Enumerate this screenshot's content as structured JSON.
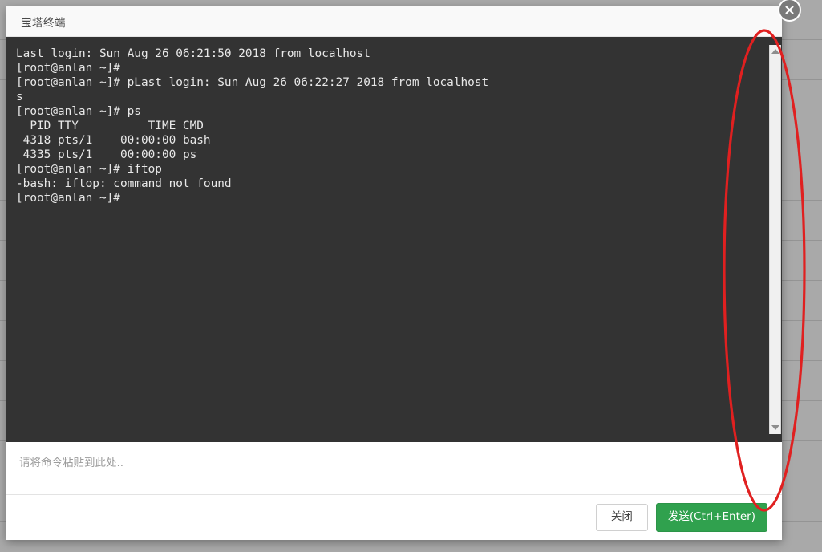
{
  "window": {
    "title": "宝塔终端",
    "close_icon": "close-circle-icon"
  },
  "terminal": {
    "background_color": "#333333",
    "text_color": "#e8e8e8",
    "lines": [
      "Last login: Sun Aug 26 06:21:50 2018 from localhost",
      "[root@anlan ~]#",
      "[root@anlan ~]# pLast login: Sun Aug 26 06:22:27 2018 from localhost",
      "s",
      "[root@anlan ~]# ps",
      "  PID TTY          TIME CMD",
      " 4318 pts/1    00:00:00 bash",
      " 4335 pts/1    00:00:00 ps",
      "[root@anlan ~]# iftop",
      "-bash: iftop: command not found",
      "[root@anlan ~]#"
    ],
    "content": "Last login: Sun Aug 26 06:21:50 2018 from localhost\n[root@anlan ~]#\n[root@anlan ~]# pLast login: Sun Aug 26 06:22:27 2018 from localhost\ns\n[root@anlan ~]# ps\n  PID TTY          TIME CMD\n 4318 pts/1    00:00:00 bash\n 4335 pts/1    00:00:00 ps\n[root@anlan ~]# iftop\n-bash: iftop: command not found\n[root@anlan ~]#"
  },
  "scrollbar": {
    "up_arrow_icon": "triangle-up-icon",
    "down_arrow_icon": "triangle-down-icon"
  },
  "input": {
    "placeholder": "请将命令粘贴到此处..",
    "value": ""
  },
  "footer": {
    "close_label": "关闭",
    "send_label": "发送(Ctrl+Enter)",
    "send_color": "#30a14e"
  },
  "annotation": {
    "shape": "ellipse",
    "color": "#e02020"
  }
}
